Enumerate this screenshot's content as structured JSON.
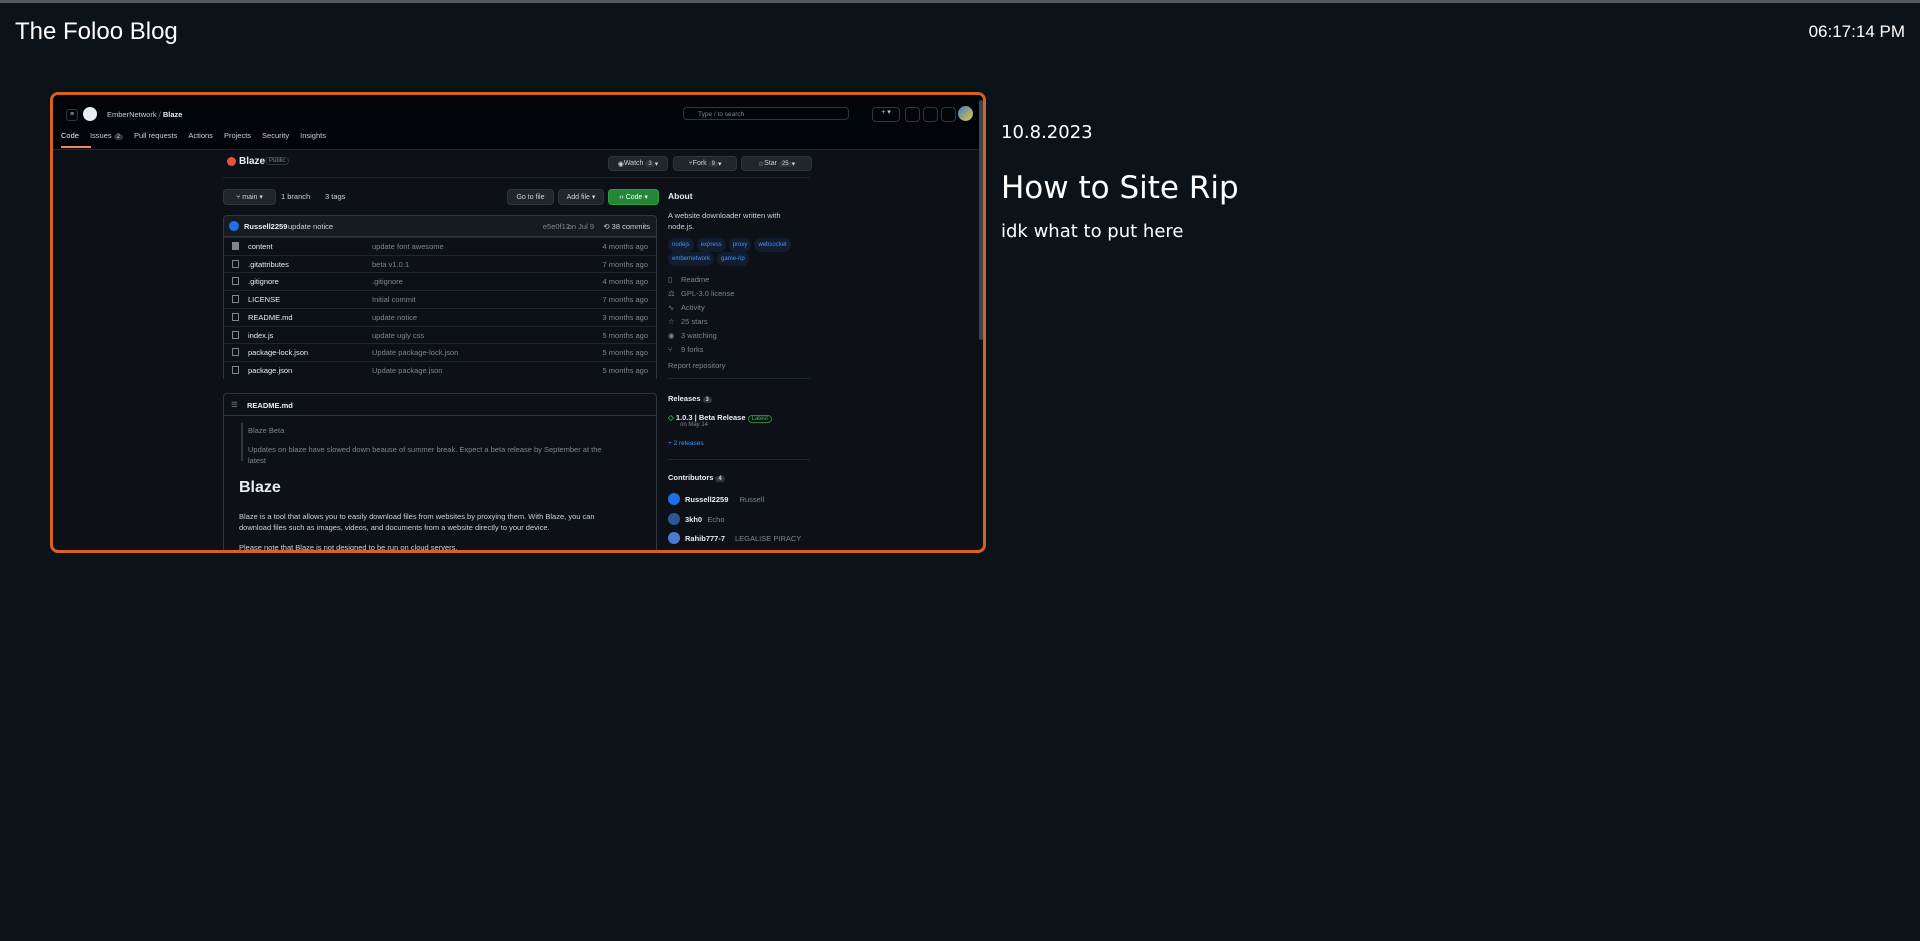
{
  "header": {
    "title": "The Foloo Blog",
    "time": "06:17:14 PM"
  },
  "post": {
    "date": "10.8.2023",
    "title": "How to Site Rip",
    "subtitle": "idk what to put here",
    "accent_color": "#d7621b"
  },
  "screenshot": {
    "owner": "EmberNetwork",
    "separator": "/",
    "repo": "Blaze",
    "search_placeholder": "Type / to search",
    "tabs": [
      {
        "label": "Code"
      },
      {
        "label": "Issues",
        "count": "2"
      },
      {
        "label": "Pull requests"
      },
      {
        "label": "Actions"
      },
      {
        "label": "Projects"
      },
      {
        "label": "Security"
      },
      {
        "label": "Insights"
      }
    ],
    "visibility": "Public",
    "watch": {
      "label": "Watch",
      "count": "3"
    },
    "fork": {
      "label": "Fork",
      "count": "9"
    },
    "star": {
      "label": "Star",
      "count": "25"
    },
    "branch": "main",
    "branches": "1 branch",
    "tags": "3 tags",
    "go_to_file": "Go to file",
    "add_file": "Add file",
    "code_button": "Code",
    "commit": {
      "author": "Russell2259",
      "message": "update notice",
      "hash": "e5e0f12",
      "date": "on Jul 9",
      "commits": "38 commits"
    },
    "files": [
      {
        "name": "content",
        "message": "update font awesome",
        "time": "4 months ago",
        "type": "folder"
      },
      {
        "name": ".gitattributes",
        "message": "beta v1.0.1",
        "time": "7 months ago",
        "type": "file"
      },
      {
        "name": ".gitignore",
        "message": ".gitignore",
        "time": "4 months ago",
        "type": "file"
      },
      {
        "name": "LICENSE",
        "message": "Initial commit",
        "time": "7 months ago",
        "type": "file"
      },
      {
        "name": "README.md",
        "message": "update notice",
        "time": "3 months ago",
        "type": "file"
      },
      {
        "name": "index.js",
        "message": "update ugly css",
        "time": "5 months ago",
        "type": "file"
      },
      {
        "name": "package-lock.json",
        "message": "Update package-lock.json",
        "time": "5 months ago",
        "type": "file"
      },
      {
        "name": "package.json",
        "message": "Update package.json",
        "time": "5 months ago",
        "type": "file"
      }
    ],
    "readme": {
      "filename": "README.md",
      "quote_title": "Blaze Beta",
      "quote_text_1": "Updates on blaze have slowed down beause of summer break. Expect a beta release by September at the",
      "quote_text_2": "latest",
      "heading": "Blaze",
      "para_1": "Blaze is a tool that allows you to easily download files from websites by proxying them. With Blaze, you can",
      "para_2": "download files such as images, videos, and documents from a website directly to your device.",
      "para_3": "Please note that Blaze is not designed to be run on cloud servers."
    },
    "about": {
      "title": "About",
      "desc_1": "A website downloader written with",
      "desc_2": "node.js.",
      "topics": [
        "nodejs",
        "express",
        "proxy",
        "websocket",
        "embernetwork",
        "game-rip"
      ],
      "items": [
        "Readme",
        "GPL-3.0 license",
        "Activity",
        "25 stars",
        "3 watching",
        "9 forks"
      ],
      "report": "Report repository"
    },
    "releases": {
      "title": "Releases",
      "count": "3",
      "name": "1.0.3 | Beta Release",
      "badge": "Latest",
      "date": "on May 14",
      "more": "+ 2 releases"
    },
    "contributors": {
      "title": "Contributors",
      "count": "4",
      "people": [
        {
          "login": "Russell2259",
          "name": "Russell"
        },
        {
          "login": "3kh0",
          "name": "Echo"
        },
        {
          "login": "Rahib777-7",
          "name": "LEGALISE PIRACY"
        }
      ]
    }
  }
}
